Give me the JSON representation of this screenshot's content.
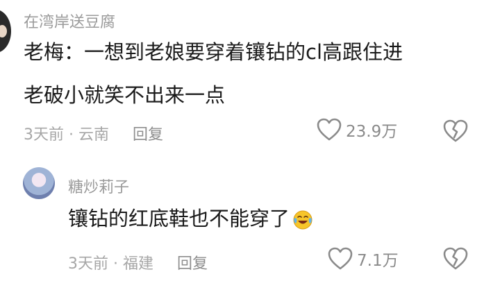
{
  "comment1": {
    "username": "在湾岸送豆腐",
    "text_line1": "老梅：一想到老娘要穿着镶钻的cl高跟住进",
    "text_line2": "老破小就笑不出来一点",
    "time_location": "3天前 · 云南",
    "reply_label": "回复",
    "likes": "23.9万"
  },
  "reply1": {
    "username": "糖炒莉子",
    "text": "镶钻的红底鞋也不能穿了",
    "emoji": "crying-laughing-emoji",
    "time_location": "3天前 · 福建",
    "reply_label": "回复",
    "likes": "7.1万"
  }
}
